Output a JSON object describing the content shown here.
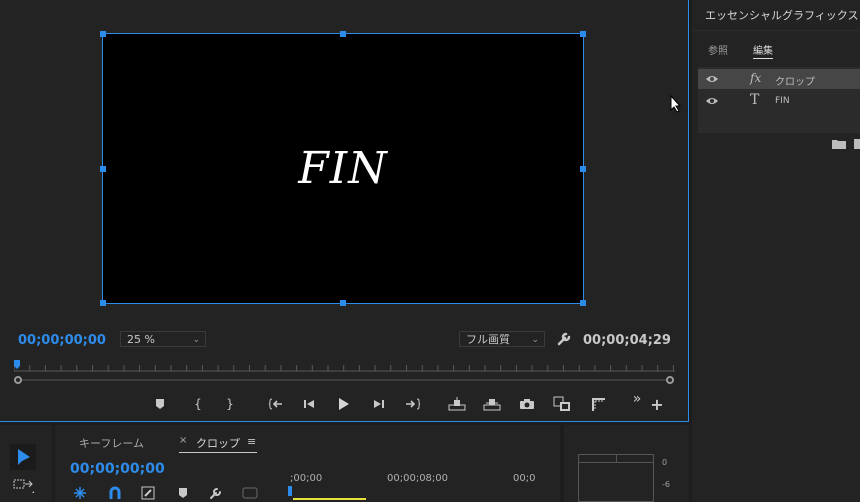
{
  "monitor": {
    "canvas_text": "FIN",
    "timecode_left": "00;00;00;00",
    "zoom": {
      "value": "25 %"
    },
    "quality": {
      "value": "フル画質"
    },
    "timecode_right": "00;00;04;29"
  },
  "essential_graphics": {
    "title": "エッセンシャルグラフィックス",
    "tabs": [
      {
        "label": "参照"
      },
      {
        "label": "編集"
      }
    ],
    "layers": [
      {
        "icon": "fx",
        "label": "クロップ",
        "selected": true
      },
      {
        "icon": "T",
        "label": "FIN",
        "selected": false
      }
    ]
  },
  "timeline": {
    "tabs": [
      {
        "label": "キーフレーム"
      },
      {
        "label": "クロップ"
      }
    ],
    "close_glyph": "×",
    "menu_glyph": "≡",
    "timecode": "00;00;00;00",
    "ruler_labels": [
      ";00;00",
      "00;00;08;00",
      "00;0"
    ]
  },
  "audio_meter": {
    "labels": [
      "0",
      "-6"
    ]
  },
  "colors": {
    "accent": "#2d8ceb",
    "panel": "#232323",
    "background": "#1d1d1d"
  }
}
